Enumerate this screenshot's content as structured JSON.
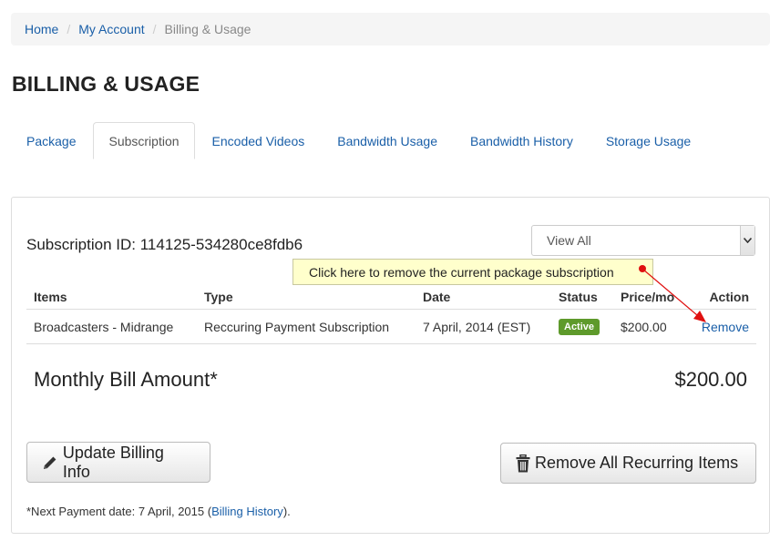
{
  "breadcrumb": {
    "home": "Home",
    "account": "My Account",
    "current": "Billing & Usage",
    "separator": "/"
  },
  "page_title": "BILLING & USAGE",
  "tabs": [
    {
      "label": "Package",
      "active": false
    },
    {
      "label": "Subscription",
      "active": true
    },
    {
      "label": "Encoded Videos",
      "active": false
    },
    {
      "label": "Bandwidth Usage",
      "active": false
    },
    {
      "label": "Bandwidth History",
      "active": false
    },
    {
      "label": "Storage Usage",
      "active": false
    }
  ],
  "subscription": {
    "id_text": "Subscription ID: 114125-534280ce8fdb6",
    "filter": {
      "selected": "View All",
      "icon": "chevron-down-icon"
    }
  },
  "tooltip": {
    "text": "Click here to remove the current package subscription"
  },
  "table": {
    "headers": {
      "items": "Items",
      "type": "Type",
      "date": "Date",
      "status": "Status",
      "price": "Price/mo",
      "action": "Action"
    },
    "rows": [
      {
        "item": "Broadcasters - Midrange",
        "type": "Reccuring Payment Subscription",
        "date": "7 April, 2014 (EST)",
        "status": "Active",
        "price": "$200.00",
        "action": "Remove"
      }
    ]
  },
  "bill": {
    "label": "Monthly Bill Amount*",
    "amount": "$200.00"
  },
  "buttons": {
    "update": {
      "label": "Update Billing Info",
      "icon": "pencil-icon"
    },
    "remove_all": {
      "label": "Remove All Recurring Items",
      "icon": "trash-icon"
    }
  },
  "footnote": {
    "prefix": "*Next Payment date: 7 April, 2015 (",
    "link": "Billing History",
    "suffix": ")."
  },
  "colors": {
    "link": "#1a5fa8",
    "badge_active": "#5e9a2b",
    "tooltip_bg": "#ffffcc",
    "arrow": "#e01010"
  }
}
